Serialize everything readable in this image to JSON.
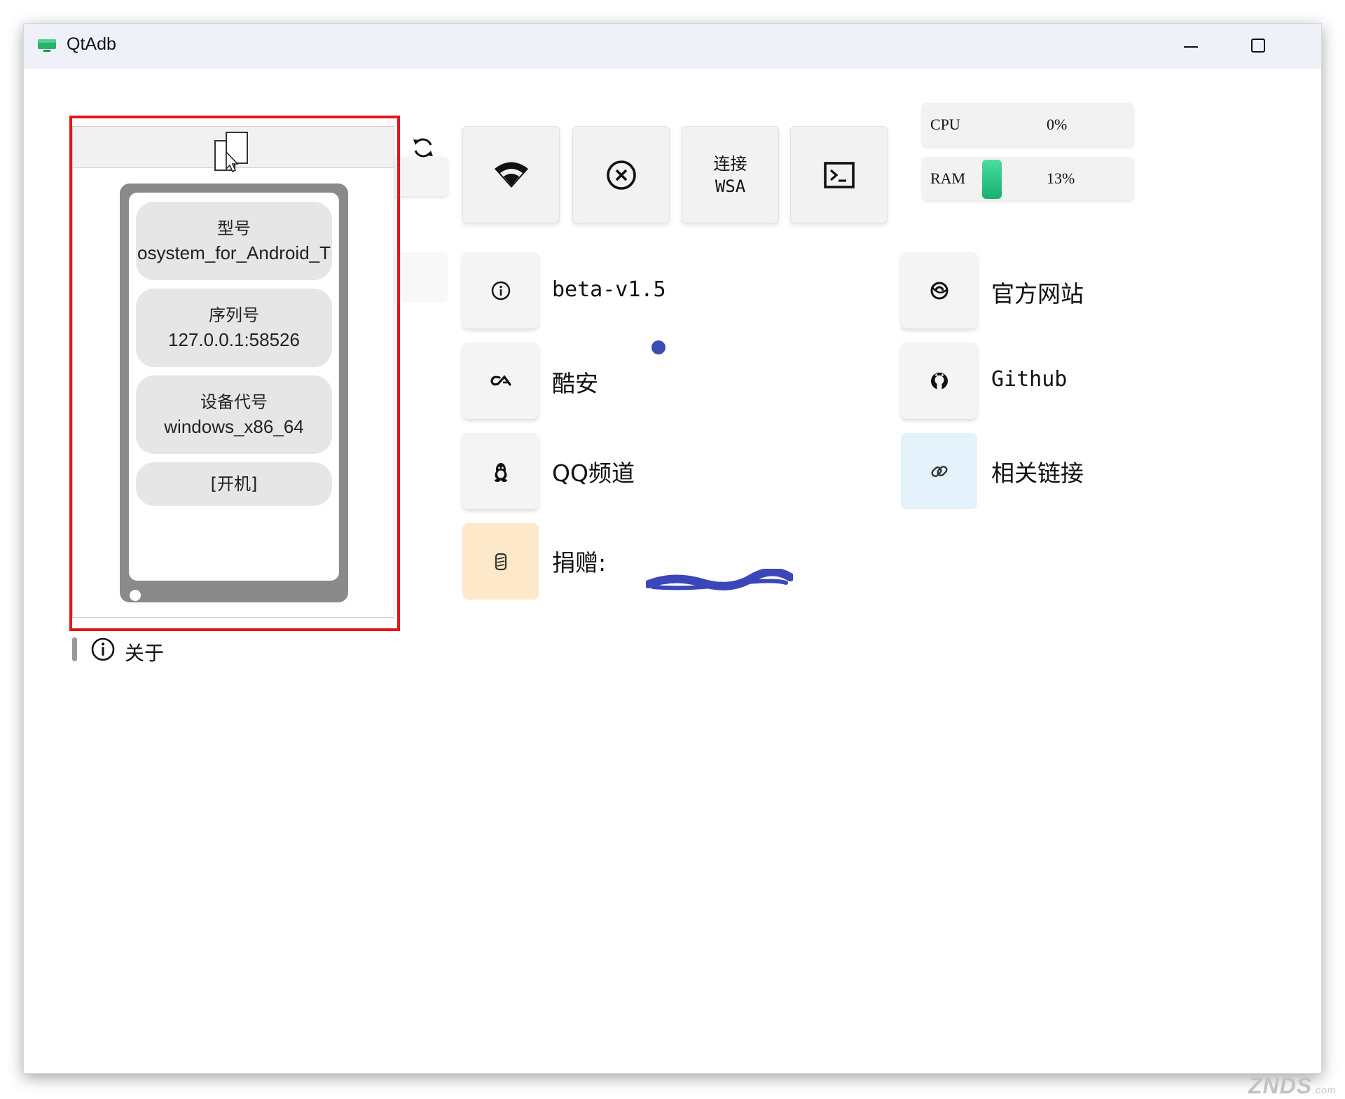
{
  "window": {
    "title": "QtAdb"
  },
  "device_card": {
    "model_label": "型号",
    "model_value": "osystem_for_Android_T",
    "serial_label": "序列号",
    "serial_value": "127.0.0.1:58526",
    "codename_label": "设备代号",
    "codename_value": "windows_x86_64",
    "state": "[开机]"
  },
  "nav": {
    "about_label": "关于"
  },
  "toolbar": {
    "wifi_icon": "wifi-icon",
    "disconnect_icon": "close-circle-icon",
    "connect_wsa_line1": "连接",
    "connect_wsa_line2": "WSA",
    "terminal_icon": "terminal-icon"
  },
  "stats": {
    "cpu_label": "CPU",
    "cpu_value": "0%",
    "ram_label": "RAM",
    "ram_value": "13%",
    "ram_fraction": 0.13
  },
  "links": {
    "version_label": "beta-v1.5",
    "website_label": "官方网站",
    "coolapk_label": "酷安",
    "github_label": "Github",
    "qq_label": "QQ频道",
    "related_label": "相关链接",
    "donate_label": "捐赠:"
  },
  "watermark": {
    "text": "ZNDS",
    "suffix": ".com"
  },
  "colors": {
    "highlight": "#e4151b",
    "ram_bar": "#2ec988",
    "accent_dot": "#3c4db0",
    "donate_tile": "#fde9c9",
    "related_tile": "#e3f2fb"
  }
}
